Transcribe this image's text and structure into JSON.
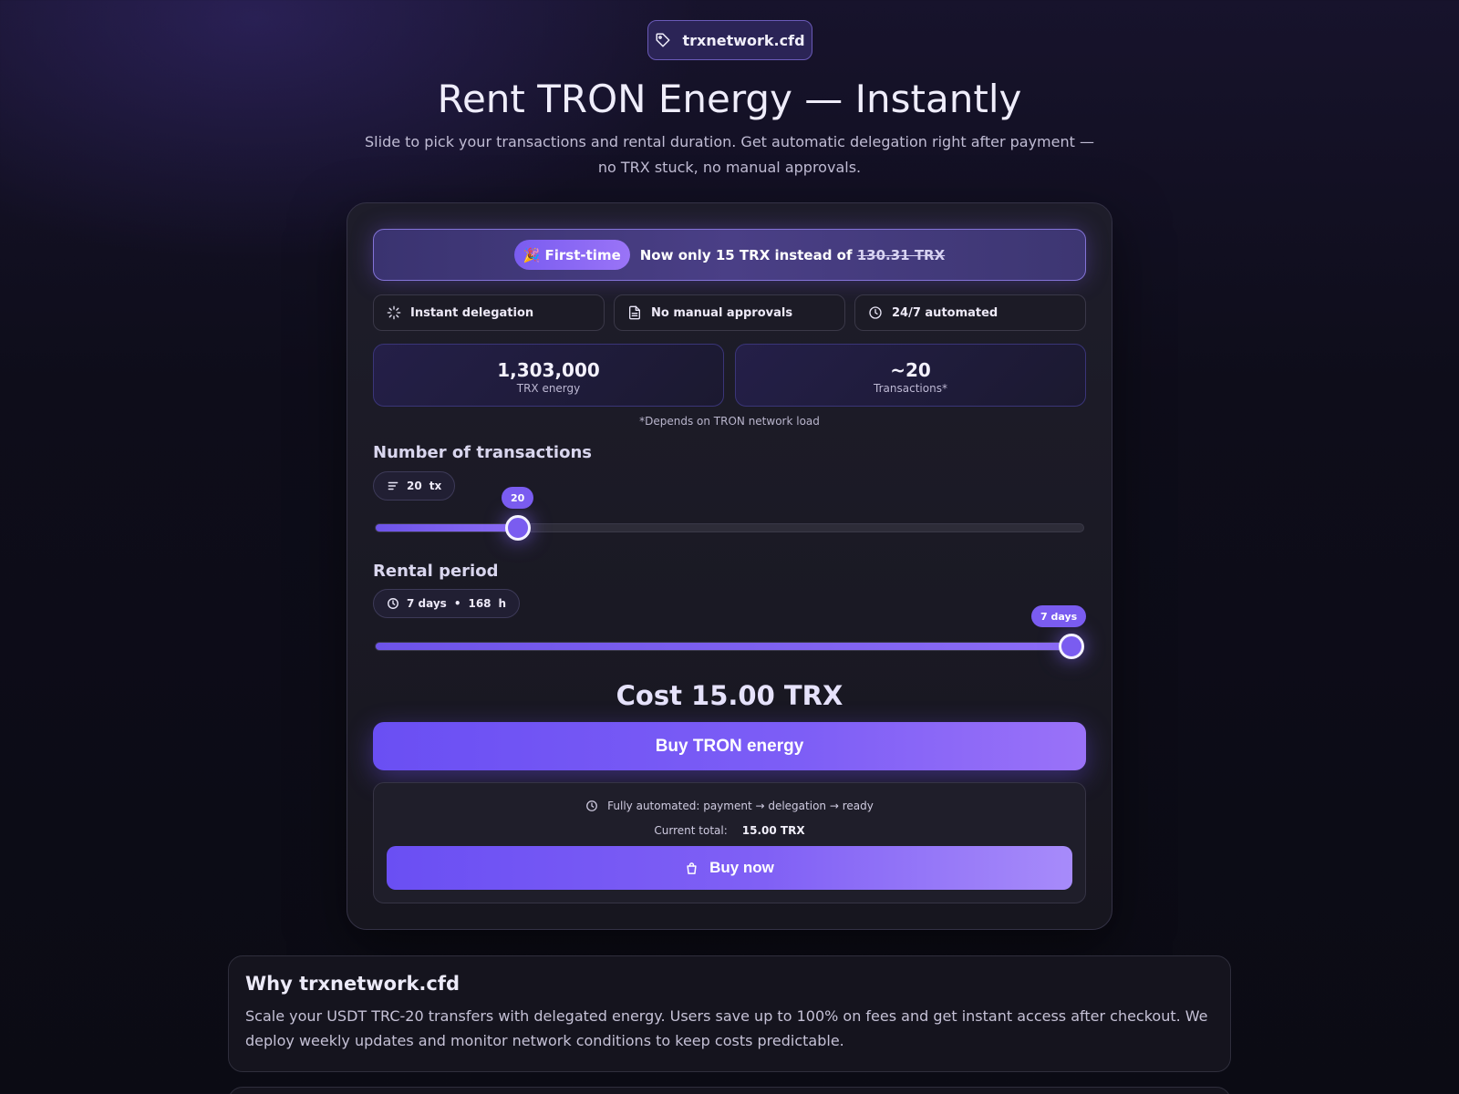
{
  "header": {
    "domain": "trxnetwork.cfd",
    "domain_icon": "tag-icon",
    "title": "Rent TRON Energy — Instantly",
    "subtitle": "Slide to pick your transactions and rental duration. Get automatic delegation right after payment — no TRX stuck, no manual approvals."
  },
  "promo": {
    "badge_emoji": "🎉",
    "badge": "First-time",
    "text": "Now only 15 TRX instead of",
    "old_price": "130.31 TRX"
  },
  "features": [
    {
      "icon": "loader-icon",
      "label": "Instant delegation"
    },
    {
      "icon": "document-icon",
      "label": "No manual approvals"
    },
    {
      "icon": "clock-icon",
      "label": "24/7 automated"
    }
  ],
  "stats": [
    {
      "value": "1,303,000",
      "label": "TRX energy"
    },
    {
      "value": "~20",
      "label": "Transactions*"
    }
  ],
  "footnote": "*Depends on TRON network load",
  "transactions": {
    "label": "Number of transactions",
    "pill_value": "20",
    "pill_unit": "tx",
    "bubble": "20",
    "value": 20,
    "fraction": 0.19
  },
  "rental": {
    "label": "Rental period",
    "pill_days": "7 days",
    "pill_sep": "•",
    "pill_hours": "168",
    "pill_unit": "h",
    "bubble": "7 days",
    "fraction": 1.0
  },
  "cost": "Cost 15.00 TRX",
  "buy_energy_label": "Buy TRON energy",
  "checkout": {
    "auto_text": "Fully automated: payment → delegation → ready",
    "total_label": "Current total:",
    "total_value": "15.00 TRX",
    "buy_now_label": "Buy now"
  },
  "why": {
    "title": "Why trxnetwork.cfd",
    "text": "Scale your USDT TRC-20 transfers with delegated energy. Users save up to 100% on fees and get instant access after checkout. We deploy weekly updates and monitor network conditions to keep costs predictable."
  },
  "colors": {
    "accent": "#7a5cf0",
    "background": "#0e0d1a"
  }
}
